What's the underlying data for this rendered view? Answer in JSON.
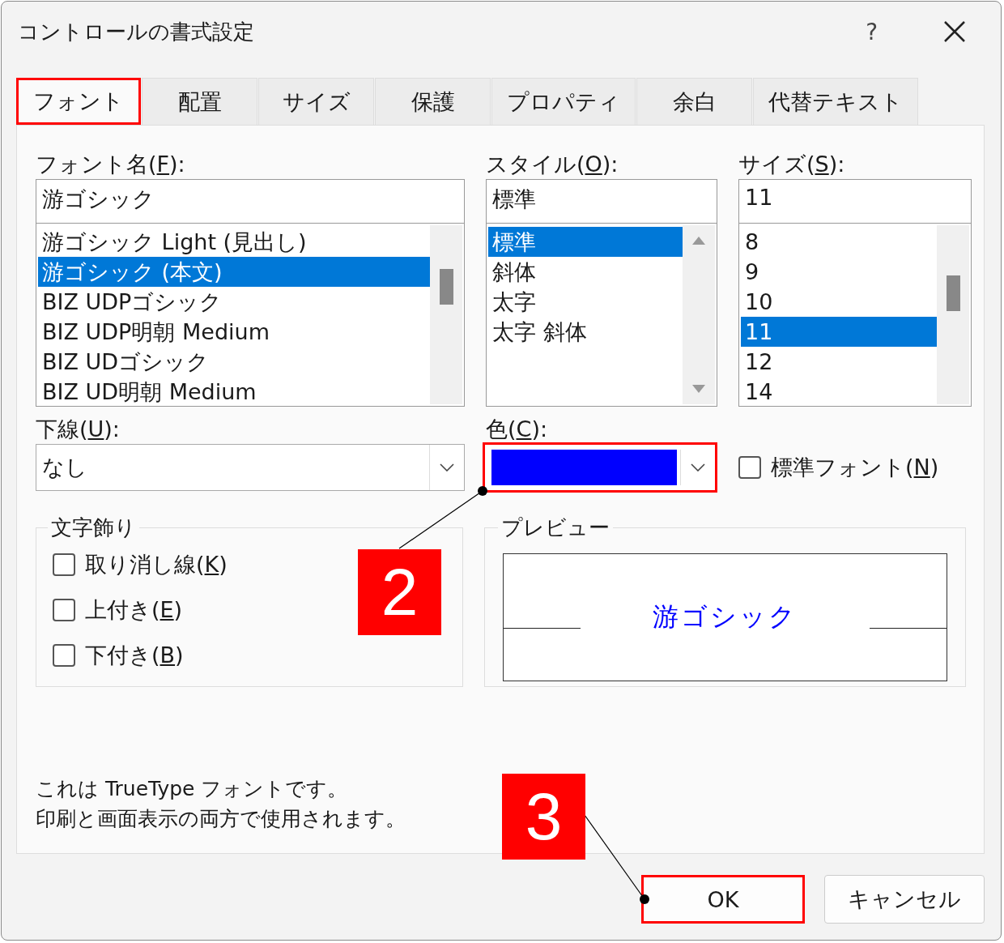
{
  "window": {
    "title": "コントロールの書式設定",
    "help": "?"
  },
  "tabs": [
    {
      "label": "フォント",
      "selected": true,
      "highlighted": true
    },
    {
      "label": "配置",
      "selected": false,
      "highlighted": false
    },
    {
      "label": "サイズ",
      "selected": false,
      "highlighted": false
    },
    {
      "label": "保護",
      "selected": false,
      "highlighted": false
    },
    {
      "label": "プロパティ",
      "selected": false,
      "highlighted": false
    },
    {
      "label": "余白",
      "selected": false,
      "highlighted": false
    },
    {
      "label": "代替テキスト",
      "selected": false,
      "highlighted": false
    }
  ],
  "font_name": {
    "label": "フォント名(",
    "mnemonic": "F",
    "label_end": "):",
    "value": "游ゴシック",
    "items": [
      {
        "text": "游ゴシック Light (見出し)",
        "selected": false
      },
      {
        "text": "游ゴシック (本文)",
        "selected": true
      },
      {
        "text": "BIZ UDPゴシック",
        "selected": false
      },
      {
        "text": "BIZ UDP明朝 Medium",
        "selected": false
      },
      {
        "text": "BIZ UDゴシック",
        "selected": false
      },
      {
        "text": "BIZ UD明朝 Medium",
        "selected": false
      }
    ]
  },
  "style": {
    "label": "スタイル(",
    "mnemonic": "O",
    "label_end": "):",
    "value": "標準",
    "items": [
      {
        "text": "標準",
        "selected": true
      },
      {
        "text": "斜体",
        "selected": false
      },
      {
        "text": "太字",
        "selected": false
      },
      {
        "text": "太字 斜体",
        "selected": false
      }
    ]
  },
  "size": {
    "label": "サイズ(",
    "mnemonic": "S",
    "label_end": "):",
    "value": "11",
    "items": [
      {
        "text": "8",
        "selected": false
      },
      {
        "text": "9",
        "selected": false
      },
      {
        "text": "10",
        "selected": false
      },
      {
        "text": "11",
        "selected": true
      },
      {
        "text": "12",
        "selected": false
      },
      {
        "text": "14",
        "selected": false
      }
    ]
  },
  "underline": {
    "label": "下線(",
    "mnemonic": "U",
    "label_end": "):",
    "value": "なし"
  },
  "color": {
    "label": "色(",
    "mnemonic": "C",
    "label_end": "):",
    "color": "#0000ff",
    "highlighted": true
  },
  "standard_font": {
    "label": "標準フォント(",
    "mnemonic": "N",
    "label_end": ")",
    "checked": false
  },
  "effects": {
    "title": "文字飾り",
    "items": [
      {
        "label": "取り消し線(",
        "mnemonic": "K",
        "label_end": ")",
        "checked": false
      },
      {
        "label": "上付き(",
        "mnemonic": "E",
        "label_end": ")",
        "checked": false
      },
      {
        "label": "下付き(",
        "mnemonic": "B",
        "label_end": ")",
        "checked": false
      }
    ]
  },
  "preview": {
    "title": "プレビュー",
    "sample": "游ゴシック"
  },
  "info": [
    "これは TrueType フォントです。",
    "印刷と画面表示の両方で使用されます。"
  ],
  "buttons": [
    {
      "label": "OK",
      "highlighted": true
    },
    {
      "label": "キャンセル",
      "highlighted": false
    }
  ],
  "annotations": [
    {
      "label": "2"
    },
    {
      "label": "3"
    }
  ]
}
